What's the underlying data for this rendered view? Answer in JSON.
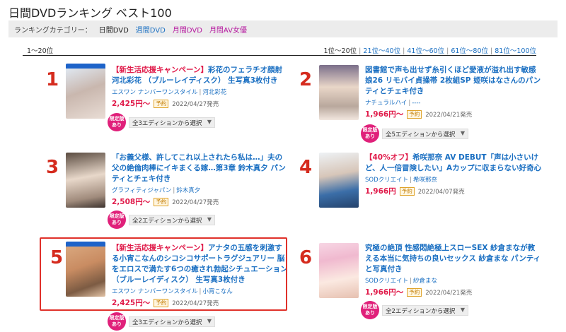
{
  "page_title": "日間DVDランキング ベスト100",
  "category_bar": {
    "label": "ランキングカテゴリー：",
    "current": "日間DVD",
    "links": [
      "週間DVD",
      "月間DVD",
      "月間AV女優"
    ]
  },
  "range": {
    "current": "1〜20位",
    "links": [
      "1位〜20位",
      "21位〜40位",
      "41位〜60位",
      "61位〜80位",
      "81位〜100位"
    ],
    "separator": "|"
  },
  "colors": {
    "rank": "#d52b1e",
    "price": "#e01b4a",
    "link": "#1a6fc2",
    "badge": "#e0207a",
    "highlight": "#e0312a"
  },
  "items": [
    {
      "rank": "1",
      "campaign": "【新生活応援キャンペーン】",
      "title": "彩花のフェラチオ顔射 河北彩花 （ブルーレイディスク） 生写真3枚付き",
      "maker": "エスワン ナンバーワンスタイル",
      "actress": "河北彩花",
      "price": "2,425円〜",
      "yoyaku": "予約",
      "date": "2022/04/27発売",
      "badge": "限定版あり",
      "editions": "全3エディションから選択"
    },
    {
      "rank": "2",
      "campaign": "",
      "title": "図書館で声も出せず糸引くほど愛液が溢れ出す敏感娘26 リモバイ貞操帯 2枚組SP 姫咲はなさんのパンティとチェキ付き",
      "maker": "ナチュラルハイ",
      "actress": "----",
      "price": "1,966円〜",
      "yoyaku": "予約",
      "date": "2022/04/21発売",
      "badge": "限定版あり",
      "editions": "全5エディションから選択"
    },
    {
      "rank": "3",
      "campaign": "",
      "title": "「お義父様、許してこれ以上されたら私は…」夫の父の絶倫肉棒にイキまくる嫁…第3章 鈴木真夕 パンティとチェキ付き",
      "maker": "グラフィティジャパン",
      "actress": "鈴木真夕",
      "price": "2,508円〜",
      "yoyaku": "予約",
      "date": "2022/04/27発売",
      "badge": "限定版あり",
      "editions": "全2エディションから選択"
    },
    {
      "rank": "4",
      "campaign": "【40%オフ】",
      "title": "希咲那奈 AV DEBUT「声は小さいけど、人一倍冒険したい」Aカップに収まらない好奇心",
      "maker": "SODクリエイト",
      "actress": "希咲那奈",
      "price": "1,966円",
      "yoyaku": "予約",
      "date": "2022/04/07発売",
      "badge": "",
      "editions": ""
    },
    {
      "rank": "5",
      "campaign": "【新生活応援キャンペーン】",
      "title": "アナタの五感を刺激する小宵こなんのシコシコサポートラグジュアリー 脳をエロスで満たす6つの癒され勃起シチュエーション （ブルーレイディスク） 生写真3枚付き",
      "maker": "エスワン ナンバーワンスタイル",
      "actress": "小宵こなん",
      "price": "2,425円〜",
      "yoyaku": "予約",
      "date": "2022/04/27発売",
      "badge": "限定版あり",
      "editions": "全3エディションから選択"
    },
    {
      "rank": "6",
      "campaign": "",
      "title": "究極の絶頂 性感悶絶極上スローSEX 紗倉まなが教える本当に気持ちの良いセックス 紗倉まな パンティと写真付き",
      "maker": "SODクリエイト",
      "actress": "紗倉まな",
      "price": "1,966円〜",
      "yoyaku": "予約",
      "date": "2022/04/21発売",
      "badge": "限定版あり",
      "editions": "全2エディションから選択"
    }
  ]
}
